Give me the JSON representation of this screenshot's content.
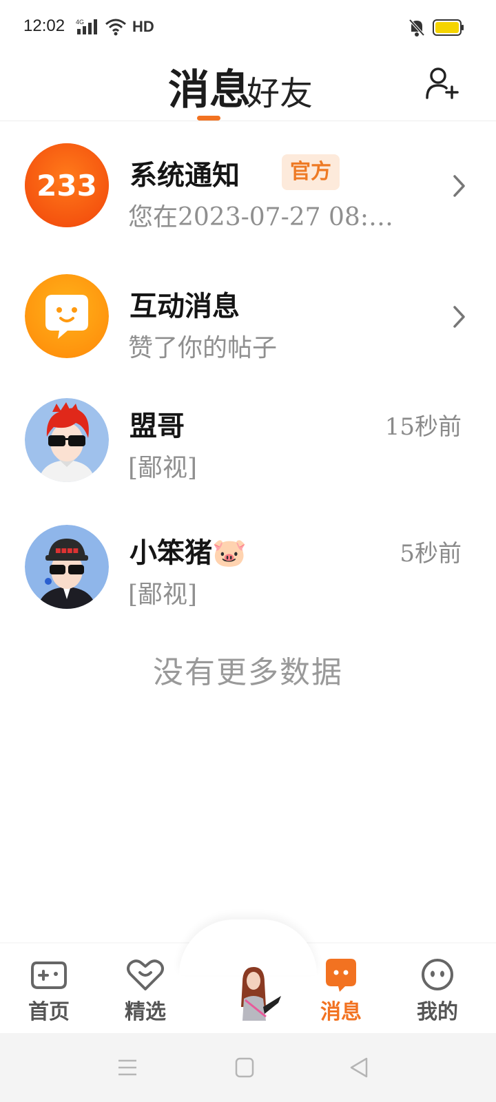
{
  "status_bar": {
    "time": "12:02",
    "network": "4G",
    "hd": "HD"
  },
  "header": {
    "tab_messages": "消息",
    "tab_friends": "好友",
    "active_tab": "消息"
  },
  "conversations": [
    {
      "name": "系统通知",
      "badge": "官方",
      "preview": "您在2023-07-27 08:…",
      "avatar_text": "233",
      "time": "",
      "has_chevron": true
    },
    {
      "name": "互动消息",
      "preview": "赞了你的帖子",
      "time": "",
      "has_chevron": true
    },
    {
      "name": "盟哥",
      "preview": "[鄙视]",
      "time": "15秒前",
      "has_chevron": false
    },
    {
      "name": "小笨猪🐷",
      "preview": "[鄙视]",
      "time": "5秒前",
      "has_chevron": false
    }
  ],
  "list_footer": "没有更多数据",
  "bottom_nav": {
    "items": [
      {
        "label": "首页",
        "icon": "gamepad-icon",
        "active": false
      },
      {
        "label": "精选",
        "icon": "heart-chat-icon",
        "active": false
      },
      {
        "label": "",
        "icon": "character-avatar-icon",
        "active": false
      },
      {
        "label": "消息",
        "icon": "message-bubble-icon",
        "active": true
      },
      {
        "label": "我的",
        "icon": "face-icon",
        "active": false
      }
    ]
  },
  "colors": {
    "accent": "#f27221",
    "badge_bg": "#fdeadb",
    "text_secondary": "#8f8f8f"
  }
}
